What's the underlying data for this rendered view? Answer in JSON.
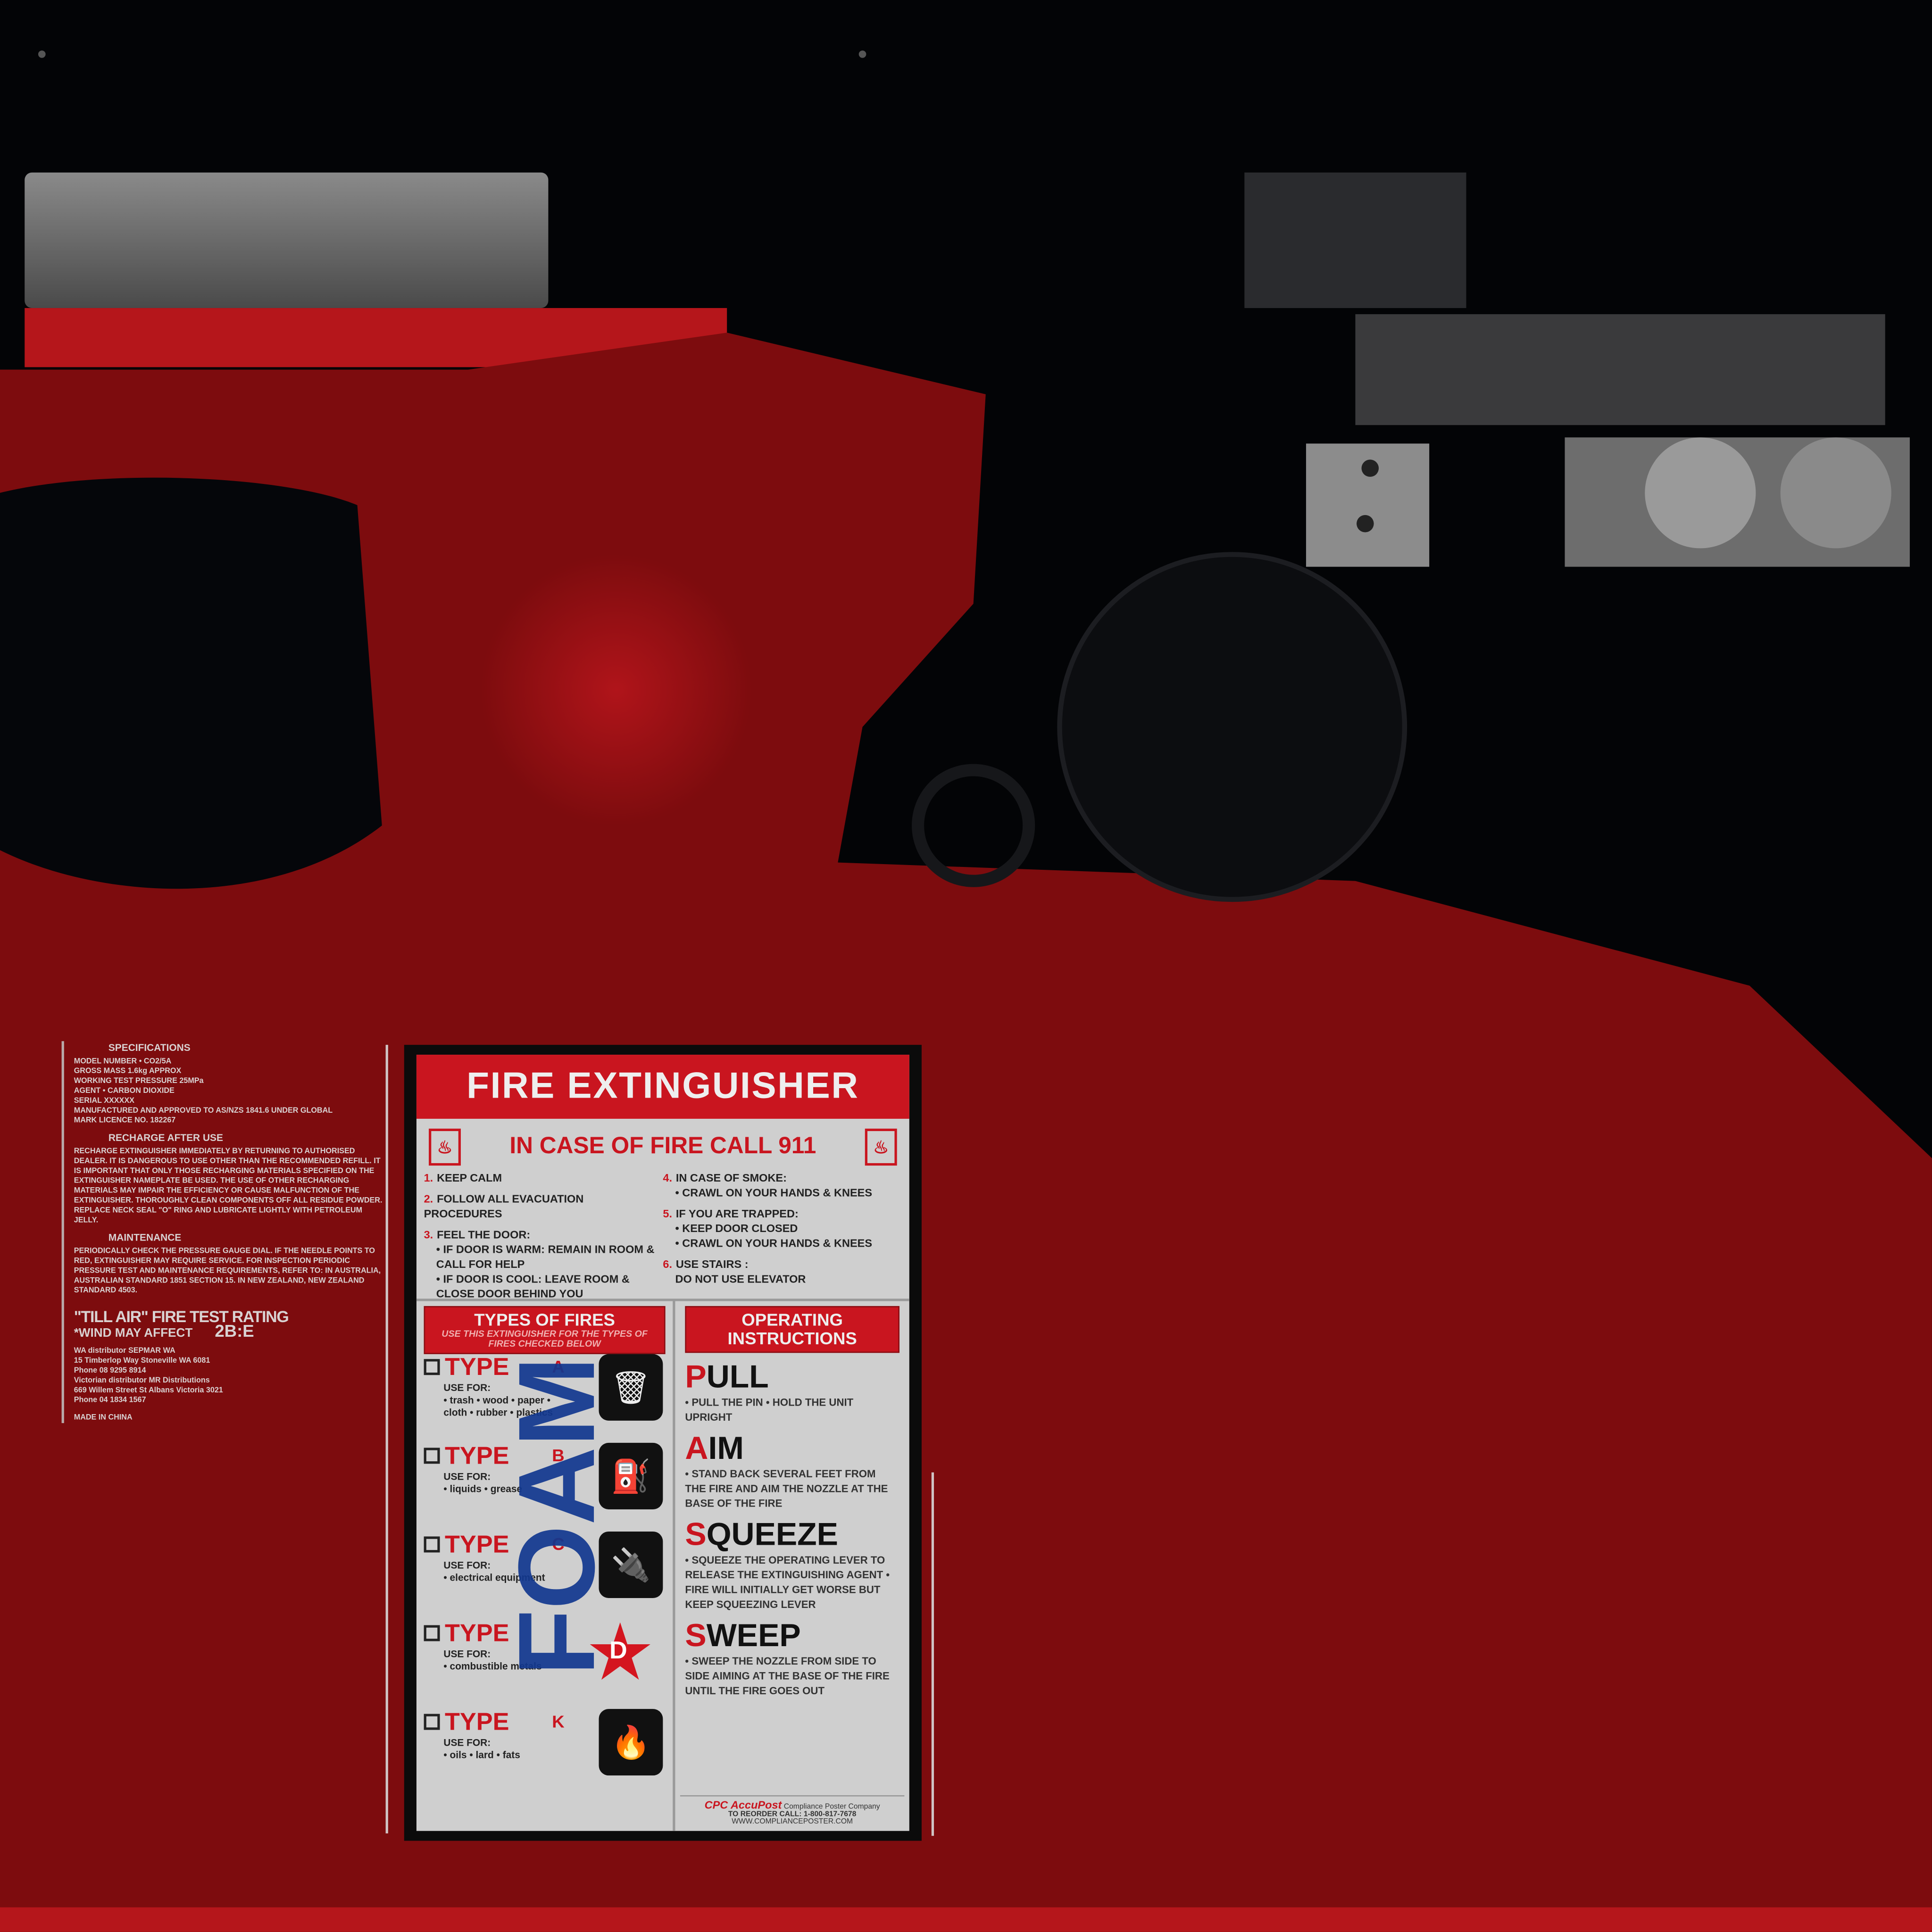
{
  "colors": {
    "body_red": "#7d0c0e",
    "label_red": "#c9151f",
    "foam_blue": "#12388f",
    "dark": "#030406"
  },
  "specs": {
    "headings": [
      "SPECIFICATIONS",
      "RECHARGE AFTER USE",
      "MAINTENANCE"
    ],
    "spec_lines": [
      "MODEL NUMBER • CO2/5A",
      "GROSS MASS 1.6kg APPROX",
      "WORKING TEST PRESSURE 25MPa",
      "AGENT • CARBON DIOXIDE",
      "SERIAL XXXXXX",
      "MANUFACTURED AND APPROVED TO AS/NZS 1841.6 UNDER GLOBAL",
      "MARK LICENCE NO. 182267"
    ],
    "recharge_text": "RECHARGE EXTINGUISHER IMMEDIATELY BY RETURNING TO AUTHORISED DEALER. IT IS DANGEROUS TO USE OTHER THAN THE RECOMMENDED REFILL. IT IS IMPORTANT THAT ONLY THOSE RECHARGING MATERIALS SPECIFIED ON THE EXTINGUISHER NAMEPLATE BE USED. THE USE OF OTHER RECHARGING MATERIALS MAY IMPAIR THE EFFICIENCY OR CAUSE MALFUNCTION OF THE EXTINGUISHER. THOROUGHLY CLEAN COMPONENTS OFF ALL RESIDUE POWDER. REPLACE NECK SEAL \"O\" RING AND LUBRICATE LIGHTLY WITH PETROLEUM JELLY.",
    "maintenance_text": "PERIODICALLY CHECK THE PRESSURE GAUGE DIAL. IF THE NEEDLE POINTS TO RED, EXTINGUISHER MAY REQUIRE SERVICE. FOR INSPECTION PERIODIC PRESSURE TEST AND MAINTENANCE REQUIREMENTS, REFER TO: IN AUSTRALIA, AUSTRALIAN STANDARD 1851 SECTION 15. IN NEW ZEALAND, NEW ZEALAND STANDARD 4503.",
    "rating_title": "\"TILL AIR\" FIRE TEST RATING",
    "rating_note": "*WIND MAY AFFECT",
    "rating_value": "2B:E",
    "distributor_lines": [
      "WA distributor SEPMAR WA",
      "15 Timberlop Way Stoneville WA 6081",
      "Phone 08 9295 8914",
      "Victorian distributor MR Distributions",
      "669 Willem Street St Albans Victoria 3021",
      "Phone 04 1834 1567"
    ],
    "origin": "MADE IN CHINA"
  },
  "poster": {
    "title": "FIRE EXTINGUISHER",
    "call": "IN CASE OF FIRE CALL 911",
    "steps_left": [
      {
        "n": "1.",
        "text": "KEEP CALM",
        "subs": []
      },
      {
        "n": "2.",
        "text": "FOLLOW ALL EVACUATION PROCEDURES",
        "subs": []
      },
      {
        "n": "3.",
        "text": "FEEL THE DOOR:",
        "subs": [
          "• IF DOOR IS WARM: REMAIN IN ROOM & CALL FOR HELP",
          "• IF DOOR IS COOL: LEAVE ROOM & CLOSE DOOR BEHIND YOU"
        ]
      }
    ],
    "steps_right": [
      {
        "n": "4.",
        "text": "IN CASE OF SMOKE:",
        "subs": [
          "• CRAWL ON YOUR HANDS & KNEES"
        ]
      },
      {
        "n": "5.",
        "text": "IF YOU ARE TRAPPED:",
        "subs": [
          "• KEEP DOOR CLOSED",
          "• CRAWL ON YOUR HANDS & KNEES"
        ]
      },
      {
        "n": "6.",
        "text": "USE STAIRS :",
        "subs": [
          "DO NOT USE ELEVATOR"
        ]
      }
    ],
    "types_header": "TYPES OF FIRES",
    "types_sub": "USE THIS EXTINGUISHER FOR THE TYPES OF FIRES CHECKED BELOW",
    "types": [
      {
        "word": "TYPE",
        "cls": "A",
        "use": "USE FOR:",
        "items": "• trash • wood • paper • cloth • rubber • plastics"
      },
      {
        "word": "TYPE",
        "cls": "B",
        "use": "USE FOR:",
        "items": "• liquids • grease"
      },
      {
        "word": "TYPE",
        "cls": "C",
        "use": "USE FOR:",
        "items": "• electrical equipment"
      },
      {
        "word": "TYPE",
        "cls": "D",
        "use": "USE FOR:",
        "items": "• combustible metals"
      },
      {
        "word": "TYPE",
        "cls": "K",
        "use": "USE FOR:",
        "items": "• oils • lard • fats"
      }
    ],
    "ops_header": "OPERATING INSTRUCTIONS",
    "ops": [
      {
        "first": "P",
        "rest": "ULL",
        "text": "• PULL THE PIN • HOLD THE UNIT UPRIGHT"
      },
      {
        "first": "A",
        "rest": "IM",
        "text": "• STAND BACK SEVERAL FEET FROM THE FIRE AND AIM THE NOZZLE AT THE BASE OF THE FIRE"
      },
      {
        "first": "S",
        "rest": "QUEEZE",
        "text": "• SQUEEZE THE OPERATING LEVER TO RELEASE THE EXTINGUISHING AGENT • FIRE WILL INITIALLY GET WORSE BUT KEEP SQUEEZING LEVER"
      },
      {
        "first": "S",
        "rest": "WEEP",
        "text": "• SWEEP THE NOZZLE FROM SIDE TO SIDE AIMING AT THE BASE OF THE FIRE UNTIL THE FIRE GOES OUT"
      }
    ],
    "footer_brand": "CPC AccuPost",
    "footer_company": "Compliance Poster Company",
    "footer_reorder": "TO REORDER CALL: 1-800-817-7678",
    "footer_url": "WWW.COMPLIANCEPOSTER.COM"
  },
  "handwriting": "FOAM"
}
